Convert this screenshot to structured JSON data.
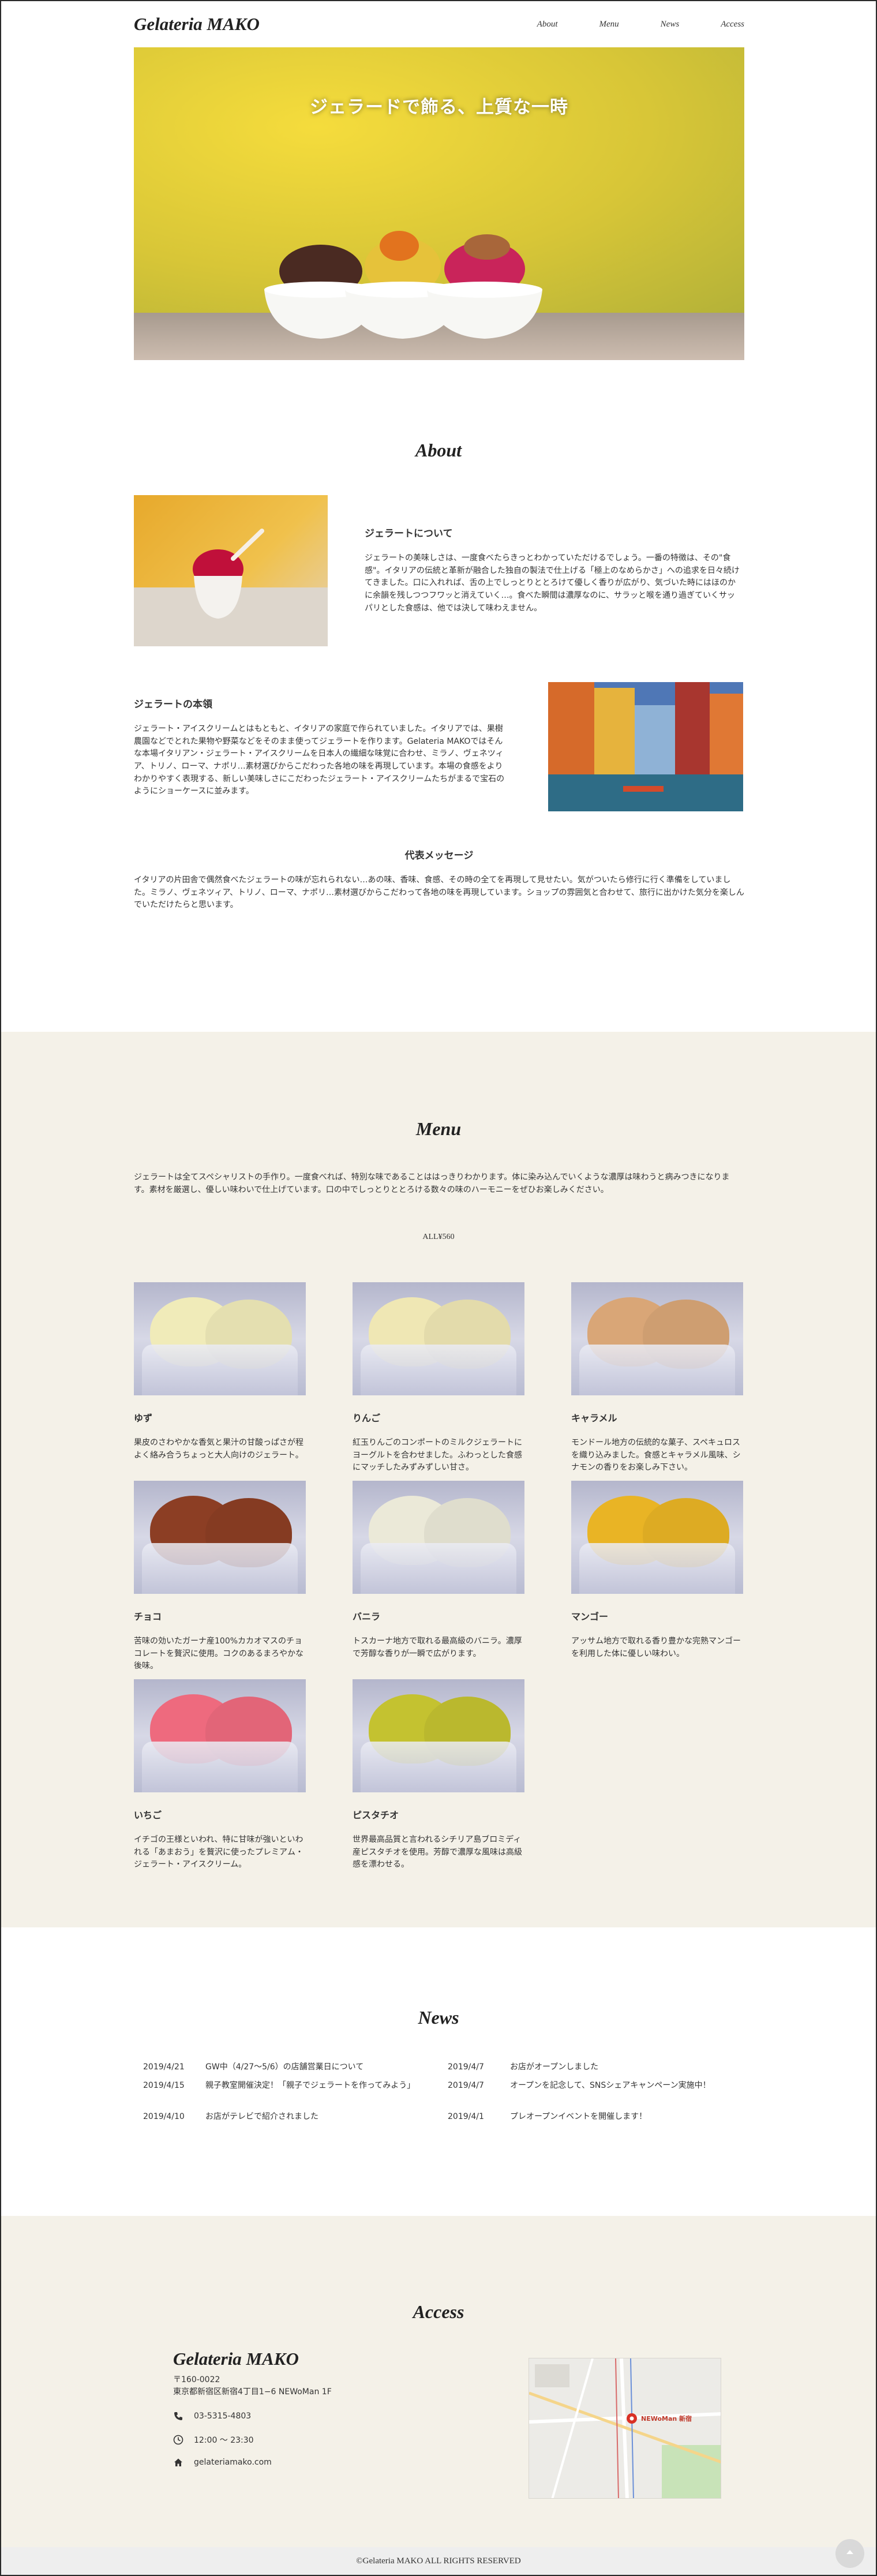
{
  "header": {
    "logo": "Gelateria MAKO",
    "nav": [
      "About",
      "Menu",
      "News",
      "Access"
    ]
  },
  "hero": {
    "title": "ジェラードで飾る、上質な一時"
  },
  "about": {
    "title": "About",
    "block1": {
      "heading": "ジェラートについて",
      "text": "ジェラートの美味しさは、一度食べたらきっとわかっていただけるでしょう。一番の特徴は、その\"食感\"。イタリアの伝統と革新が融合した独自の製法で仕上げる「極上のなめらかさ」への追求を日々続けてきました。口に入れれば、舌の上でしっとりととろけて優しく香りが広がり、気づいた時にはほのかに余韻を残しつつフワッと消えていく…。食べた瞬間は濃厚なのに、サラッと喉を通り過ぎていくサッパリとした食感は、他では決して味わえません。"
    },
    "block2": {
      "heading": "ジェラートの本領",
      "text": "ジェラート・アイスクリームとはもともと、イタリアの家庭で作られていました。イタリアでは、果樹農園などでとれた果物や野菜などをそのまま使ってジェラートを作ります。Gelateria MAKOではそんな本場イタリアン・ジェラート・アイスクリームを日本人の繊細な味覚に合わせ、ミラノ、ヴェネツィア、トリノ、ローマ、ナポリ…素材選びからこだわった各地の味を再現しています。本場の食感をよりわかりやすく表現する、新しい美味しさにこだわったジェラート・アイスクリームたちがまるで宝石のようにショーケースに並みます。"
    },
    "block3": {
      "heading": "代表メッセージ",
      "text": "イタリアの片田舎で偶然食べたジェラートの味が忘れられない…あの味、香味、食感、その時の全てを再現して見せたい。気がついたら修行に行く準備をしていました。ミラノ、ヴェネツィア、トリノ、ローマ、ナポリ…素材選びからこだわって各地の味を再現しています。ショップの雰囲気と合わせて、旅行に出かけた気分を楽しんでいただけたらと思います。"
    }
  },
  "menu": {
    "title": "Menu",
    "intro": "ジェラートは全てスペシャリストの手作り。一度食べれば、特別な味であることははっきりわかります。体に染み込んでいくような濃厚は味わうと病みつきになります。素材を厳選し、優しい味わいで仕上げています。口の中でしっとりととろける数々の味のハーモニーをぜひお楽しみください。",
    "price": "ALL¥560",
    "items": [
      {
        "name": "ゆず",
        "desc": "果皮のさわやかな香気と果汁の甘酸っぱさが程よく絡み合うちょっと大人向けのジェラート。",
        "color": "#f0ebb9"
      },
      {
        "name": "りんご",
        "desc": "紅玉りんごのコンポートのミルクジェラートにヨーグルトを合わせました。ふわっとした食感にマッチしたみずみずしい甘さ。",
        "color": "#efe7b4"
      },
      {
        "name": "キャラメル",
        "desc": "モンドール地方の伝統的な菓子、スペキュロスを織り込みました。食感とキャラメル風味、シナモンの香りをお楽しみ下さい。",
        "color": "#d9a677"
      },
      {
        "name": "チョコ",
        "desc": "苦味の効いたガーナ産100%カカオマスのチョコレートを贅沢に使用。コクのあるまろやかな後味。",
        "color": "#8c3e24"
      },
      {
        "name": "バニラ",
        "desc": "トスカーナ地方で取れる最高級のバニラ。濃厚で芳醇な香りが一瞬で広がります。",
        "color": "#ebe9d8"
      },
      {
        "name": "マンゴー",
        "desc": "アッサム地方で取れる香り豊かな完熟マンゴーを利用した体に優しい味わい。",
        "color": "#e9b425"
      },
      {
        "name": "いちご",
        "desc": "イチゴの王様といわれ、特に甘味が強いといわれる「あまおう」を贅沢に使ったプレミアム・ジェラート・アイスクリーム。",
        "color": "#ee6a7e"
      },
      {
        "name": "ピスタチオ",
        "desc": "世界最高品質と言われるシチリア島ブロミディ産ピスタチオを使用。芳醇で濃厚な風味は高級感を漂わせる。",
        "color": "#c4c230"
      }
    ]
  },
  "news": {
    "title": "News",
    "left": [
      {
        "date": "2019/4/21",
        "title": "GW中（4/27〜5/6）の店舗営業日について"
      },
      {
        "date": "2019/4/15",
        "title": "親子教室開催決定！「親子でジェラートを作ってみよう」"
      },
      {
        "date": "2019/4/10",
        "title": "お店がテレビで紹介されました"
      }
    ],
    "right": [
      {
        "date": "2019/4/7",
        "title": "お店がオープンしました"
      },
      {
        "date": "2019/4/7",
        "title": "オープンを記念して、SNSシェアキャンペーン実施中！"
      },
      {
        "date": "2019/4/1",
        "title": "プレオープンイベントを開催します！"
      }
    ]
  },
  "access": {
    "title": "Access",
    "shop_name": "Gelateria MAKO",
    "postal": "〒160-0022",
    "address": "東京都新宿区新宿4丁目1−6 NEWoMan 1F",
    "phone": "03-5315-4803",
    "hours": "12:00 ～ 23:30",
    "site": "gelateriamako.com",
    "map_label": "NEWoMan 新宿"
  },
  "footer": {
    "copyright": "©Gelateria MAKO ALL RIGHTS RESERVED"
  },
  "icons": [
    "phone-icon",
    "clock-icon",
    "home-icon",
    "arrow-up-icon"
  ]
}
